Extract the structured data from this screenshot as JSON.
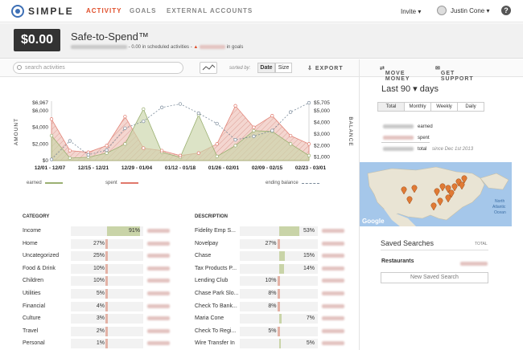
{
  "brand": {
    "name": "SIMPLE"
  },
  "nav": {
    "activity": "ACTIVITY",
    "goals": "GOALS",
    "external": "EXTERNAL ACCOUNTS"
  },
  "header_right": {
    "invite": "Invite ▾",
    "user": "Justin Cone ▾",
    "help": "?"
  },
  "safe_to_spend": {
    "amount": "$0.00",
    "title": "Safe-to-Spend™",
    "scheduled": "- 0.00 in scheduled activities -",
    "goals": "in goals"
  },
  "toolbar": {
    "search_placeholder": "search activities",
    "sorted_by": "sorted by:",
    "sort_date": "Date",
    "sort_size": "Size",
    "export": "EXPORT"
  },
  "right_toolbar": {
    "move_money": "MOVE MONEY",
    "get_support": "GET SUPPORT"
  },
  "chart_data": {
    "type": "area",
    "ylabel_left": "AMOUNT",
    "ylabel_right": "BALANCE",
    "left_ticks": [
      "$6,967",
      "$6,000",
      "$4,000",
      "$2,000",
      "$0"
    ],
    "right_ticks": [
      "$5,705",
      "$5,000",
      "$4,000",
      "$3,000",
      "$2,000",
      "$1,000"
    ],
    "categories": [
      "12/01 - 12/07",
      "12/15 - 12/21",
      "12/29 - 01/04",
      "01/12 - 01/18",
      "01/26 - 02/01",
      "02/09 - 02/15",
      "02/23 - 03/01"
    ],
    "ylim": [
      0,
      6967
    ],
    "y2lim": [
      700,
      5705
    ],
    "series": [
      {
        "name": "earned",
        "color": "#9bb072",
        "values": [
          3000,
          300,
          400,
          900,
          2000,
          6200,
          1000,
          400,
          5500,
          500,
          1800,
          3600,
          3500,
          2000,
          600
        ]
      },
      {
        "name": "spent",
        "color": "#e0786b",
        "values": [
          5000,
          1200,
          1000,
          1800,
          5300,
          1500,
          1200,
          600,
          900,
          2000,
          6600,
          4000,
          5400,
          3000,
          2000
        ]
      },
      {
        "name": "ending balance",
        "color": "#7a8a9a",
        "values": [
          800,
          2400,
          1200,
          1600,
          3500,
          4100,
          5300,
          5600,
          4800,
          3900,
          2500,
          2800,
          3300,
          4900,
          5700
        ]
      }
    ]
  },
  "legend": {
    "earned": "earned",
    "spent": "spent",
    "balance": "ending balance"
  },
  "category_table": {
    "header": "CATEGORY",
    "rows": [
      {
        "name": "Income",
        "pct": "91%",
        "value": 0.91,
        "kind": "earned"
      },
      {
        "name": "Home",
        "pct": "27%",
        "value": 0.27,
        "kind": "spent"
      },
      {
        "name": "Uncategorized",
        "pct": "25%",
        "value": 0.25,
        "kind": "spent"
      },
      {
        "name": "Food & Drink",
        "pct": "10%",
        "value": 0.1,
        "kind": "spent"
      },
      {
        "name": "Children",
        "pct": "10%",
        "value": 0.1,
        "kind": "spent"
      },
      {
        "name": "Utilities",
        "pct": "5%",
        "value": 0.05,
        "kind": "spent"
      },
      {
        "name": "Financial",
        "pct": "4%",
        "value": 0.04,
        "kind": "spent"
      },
      {
        "name": "Culture",
        "pct": "3%",
        "value": 0.03,
        "kind": "spent"
      },
      {
        "name": "Travel",
        "pct": "2%",
        "value": 0.02,
        "kind": "spent"
      },
      {
        "name": "Personal",
        "pct": "1%",
        "value": 0.01,
        "kind": "spent"
      }
    ]
  },
  "description_table": {
    "header": "DESCRIPTION",
    "rows": [
      {
        "name": "Fidelity Emp S...",
        "pct": "53%",
        "value": 0.53,
        "kind": "earned"
      },
      {
        "name": "Novelpay",
        "pct": "27%",
        "value": 0.27,
        "kind": "spent"
      },
      {
        "name": "Chase",
        "pct": "15%",
        "value": 0.15,
        "kind": "earned"
      },
      {
        "name": "Tax Products P...",
        "pct": "14%",
        "value": 0.14,
        "kind": "earned"
      },
      {
        "name": "Lending Club",
        "pct": "10%",
        "value": 0.1,
        "kind": "spent"
      },
      {
        "name": "Chase Park Slo...",
        "pct": "8%",
        "value": 0.08,
        "kind": "spent"
      },
      {
        "name": "Check To Bank...",
        "pct": "8%",
        "value": 0.08,
        "kind": "spent"
      },
      {
        "name": "Maria Cone",
        "pct": "7%",
        "value": 0.07,
        "kind": "earned"
      },
      {
        "name": "Check To Regi...",
        "pct": "5%",
        "value": 0.05,
        "kind": "spent"
      },
      {
        "name": "Wire Transfer In",
        "pct": "5%",
        "value": 0.05,
        "kind": "earned"
      }
    ]
  },
  "right_panel": {
    "period": "Last 90 ▾ days",
    "segments": [
      "Total",
      "Monthly",
      "Weekly",
      "Daily"
    ],
    "earned": "earned",
    "spent": "spent",
    "total": "total",
    "since": "since Dec 1st 2013",
    "map_labels": {
      "google": "Google",
      "north": "North",
      "atlantic": "Atlantic",
      "ocean": "Ocean"
    },
    "saved_searches": "Saved Searches",
    "total_label": "TOTAL",
    "restaurants": "Restaurants",
    "new_saved_search": "New Saved Search"
  }
}
